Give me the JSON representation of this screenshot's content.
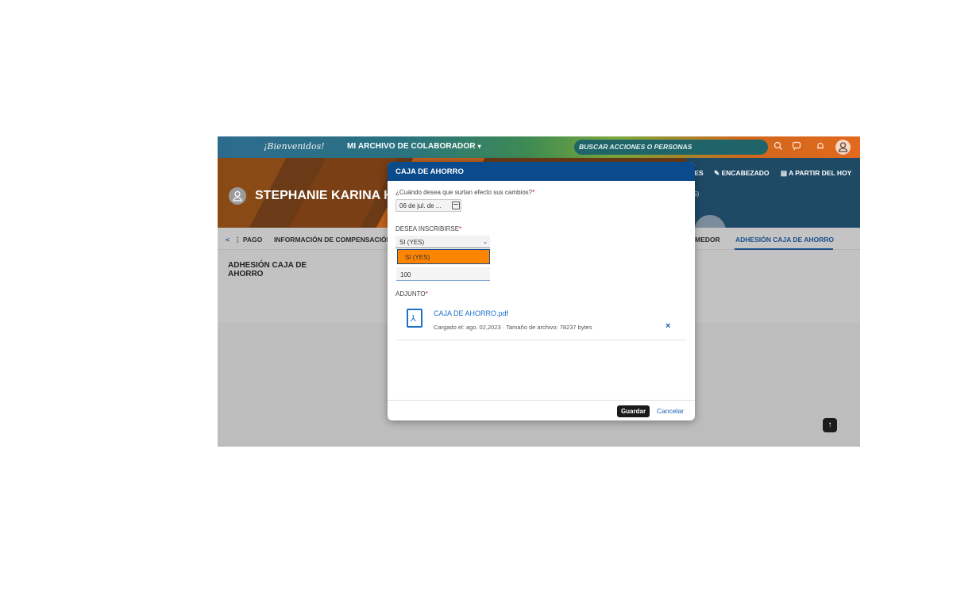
{
  "topbar": {
    "brand": "¡Bienvenidos!",
    "module": "MI ARCHIVO DE COLABORADOR",
    "search_placeholder": "BUSCAR ACCIONES O PERSONAS",
    "icons": [
      "search-icon",
      "chat-icon",
      "bell-icon",
      "user-icon"
    ]
  },
  "header": {
    "person_name": "STEPHANIE KARINA HE",
    "actions": [
      "IES",
      "ENCABEZADO",
      "A PARTIR DEL HOY"
    ],
    "partial_text": "5)"
  },
  "tabs": {
    "left_arrow": "<",
    "items": [
      "⋮ PAGO",
      "INFORMACIÓN DE COMPENSACIÓN",
      "MEDOR",
      "ADHESIÓN CAJA DE AHORRO"
    ],
    "active": "ADHESIÓN CAJA DE AHORRO"
  },
  "content": {
    "section_title": "ADHESIÓN CAJA DE AHORRO"
  },
  "dialog": {
    "title": "CAJA DE AHORRO",
    "effective_label": "¿Cuándo desea que surtan efecto sus cambios?",
    "effective_value": "06 de jul. de ...",
    "enroll_label": "DESEA INSCRIBIRSE",
    "enroll_value": "SI (YES)",
    "option_highlighted": "SI (YES)",
    "amount_value": "100",
    "attachment_label": "ADJUNTO",
    "file_name": "CAJA DE AHORRO.pdf",
    "file_meta": "Cargado el: ago. 02,2023 · Tamaño de archivo: 78237 bytes",
    "save_label": "Guardar",
    "cancel_label": "Cancelar",
    "required_mark": "*",
    "accent_color": "#0b4a8b",
    "highlight_color": "#ff8400"
  }
}
